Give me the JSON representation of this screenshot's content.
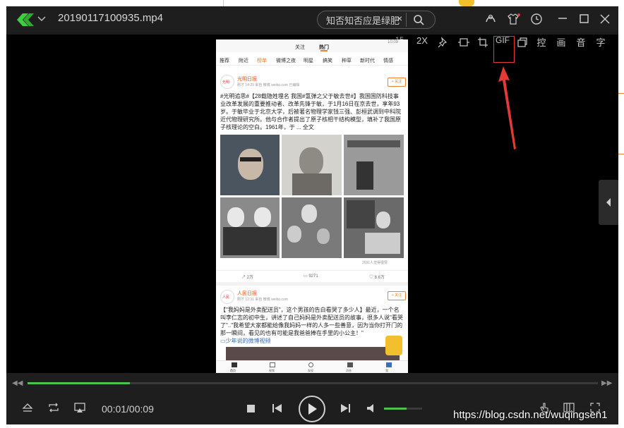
{
  "window": {
    "filename": "20190117100935.mp4",
    "search_text": "知否知否应是绿肥",
    "search_clear": "×"
  },
  "toolbar": {
    "speed": "2X",
    "gif": "GIF",
    "control": "控",
    "picture": "画",
    "audio": "音",
    "subtitle": "字",
    "top_right_num": "15"
  },
  "phone": {
    "status_time": "10:09",
    "tabs": [
      "关注",
      "热门"
    ],
    "categories": [
      "推荐",
      "附近",
      "榜单",
      "微博之夜",
      "明星",
      "搞笑",
      "种草",
      "新时代",
      "情感"
    ],
    "post1": {
      "author": "光明日报",
      "meta": "刚才 14:29 来自 微博 weibo.com 已编辑",
      "follow": "+ 关注",
      "text": "#光明追思#【28载隐姓埋名 我国#氢弹之父于敏去世#】我国国防科技事业改革发展的重要推动者、改革先锋于敏，于1月16日在京去世，享年93岁。于敏毕业于北京大学，后被著名物理学家钱三强、彭桓武调到中科院近代物理研究所。他与合作者提出了原子核相干结构模型，填补了我国原子核理论的空白。1961年，于 ... 全文",
      "likes_note": "2691人觉得很赞",
      "repost": "2万",
      "comment": "9271",
      "like": "8.6万"
    },
    "post2": {
      "author": "人民日报",
      "meta": "刚才 12:31 来自 微博 weibo.com",
      "follow": "+ 关注",
      "text": "【\"我妈妈是外卖配送员\"，这个男孩的告白看哭了多少人】最近，一个名叫李仁志的初中生，讲述了自己妈妈是外卖配送员的故事，很多人说\"看哭了\"..\"我希望大家都能给像我妈妈一样的人多一些善意，因为当你打开门的那一瞬间，看见的也有可能是我爸爸捧在手里的小公主！\"",
      "link": "少年说的微博视频"
    },
    "nav": [
      "首页",
      "视频",
      "发现",
      "消息",
      "我"
    ]
  },
  "player": {
    "time": "00:01/00:09",
    "progress": 0.18,
    "volume": 0.6
  },
  "watermark": "https://blog.csdn.net/wuqingsen1",
  "annotation_color": "#e53935"
}
